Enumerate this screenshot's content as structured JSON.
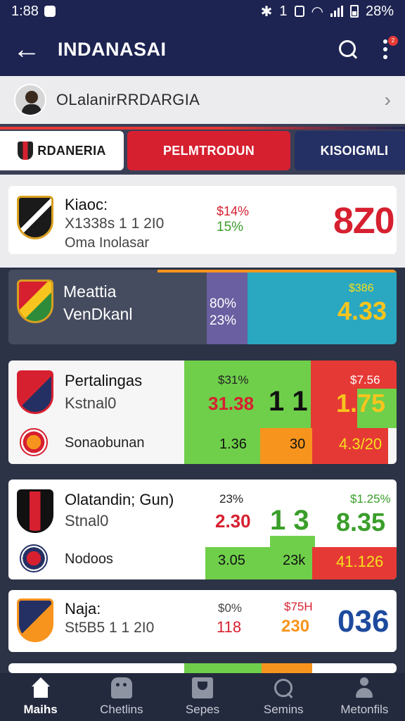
{
  "status_bar": {
    "time": "1:88",
    "signal_label": "1",
    "battery": "28%"
  },
  "app_bar": {
    "title": "INDANASAI"
  },
  "league": {
    "name": "OLalanirRRDARGIA"
  },
  "tabs": [
    {
      "label": "RDANERIA"
    },
    {
      "label": "PELMTRODUN"
    },
    {
      "label": "KISOIGMLI"
    }
  ],
  "matches": [
    {
      "team": "Kiaoc:",
      "line2": "X1338s 1 1 2I0",
      "line3": "Oma Inolasar",
      "pct_top": "$14%",
      "pct_bottom": "15%",
      "score": "8Z0"
    },
    {
      "team": "Meattia",
      "line2": "VenDkanl",
      "pct_top": "80%",
      "pct_bottom": "23%",
      "odds_label": "$386",
      "odds": "4.33"
    },
    {
      "team": "Pertalingas",
      "line2": "Kstnal0",
      "team2": "Sonaobunan",
      "odds_top": "$31%",
      "odds_mid": "31.38",
      "odds_low": "1.36",
      "score": "1 1",
      "score_low": "30",
      "right_top": "$7.56",
      "right_mid": "1.75",
      "right_low": "4.3/20"
    },
    {
      "team": "Olatandin; Gun)",
      "line2": "Stnal0",
      "team2": "Nodoos",
      "odds_top": "23%",
      "odds_mid": "2.30",
      "odds_low": "3.05",
      "score": "1 3",
      "score_low": "23k",
      "right_top": "$1.25%",
      "right_mid": "8.35",
      "right_low": "41.126"
    },
    {
      "team": "Naja:",
      "line2": "St5B5 1 1 2I0",
      "pct_top": "$0%",
      "pct_bottom": "118",
      "mid_top": "$75H",
      "mid_bottom": "230",
      "score": "036"
    }
  ],
  "nav": [
    {
      "label": "Maihs",
      "icon": "home-icon"
    },
    {
      "label": "Chetlins",
      "icon": "game-icon"
    },
    {
      "label": "Sepes",
      "icon": "cup-icon"
    },
    {
      "label": "Semins",
      "icon": "magnifier-icon"
    },
    {
      "label": "Metonfils",
      "icon": "person-icon"
    }
  ],
  "colors": {
    "navy": "#1d2452",
    "red": "#d62030",
    "green": "#6fcf4a",
    "orange": "#f7941d",
    "teal": "#2aa7c1"
  }
}
